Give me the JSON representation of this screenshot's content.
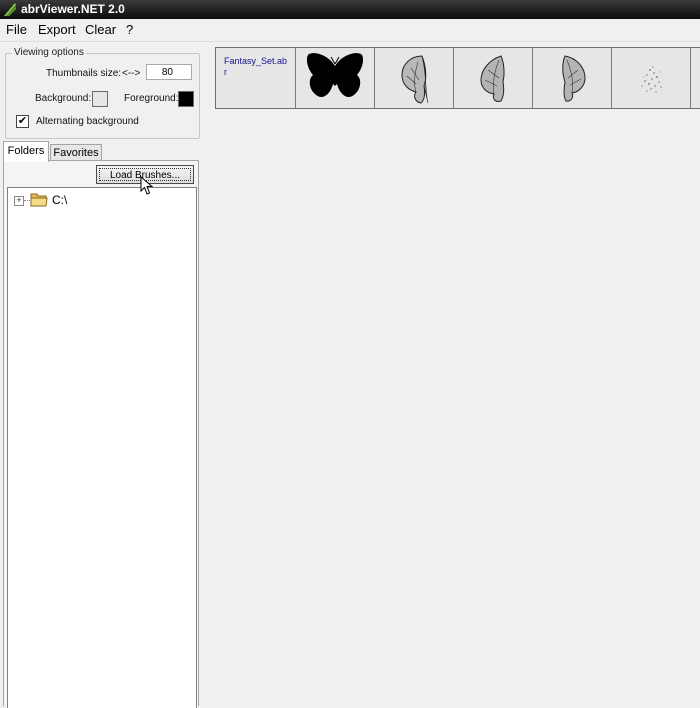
{
  "window": {
    "title": "abrViewer.NET 2.0"
  },
  "menu": [
    {
      "label": "File"
    },
    {
      "label": "Export"
    },
    {
      "label": "Clear"
    },
    {
      "label": "?"
    }
  ],
  "viewing_options": {
    "title": "Viewing options",
    "thumb_label": "Thumbnails size:",
    "thumb_arrows": "<-->",
    "thumb_value": "80",
    "background_label": "Background:",
    "background_color": "#e6e6e6",
    "foreground_label": "Foreground:",
    "foreground_color": "#000000",
    "alternating_label": "Alternating background",
    "alternating_checked": true
  },
  "tabs": [
    {
      "label": "Folders",
      "active": true
    },
    {
      "label": "Favorites",
      "active": false
    }
  ],
  "load_button": "Load Brushes...",
  "tree": [
    {
      "label": "C:\\",
      "icon": "folder-icon",
      "expander": "+"
    }
  ],
  "brush_set": {
    "name": "Fantasy_Set.abr",
    "thumbnails": [
      "butterfly-silhouette",
      "wing-pair-a",
      "wing-single-a",
      "wing-single-b",
      "sparkle-dust"
    ]
  },
  "colors": {
    "titlebar": "#1a1a1a",
    "link_text": "#14148c",
    "panel_bg": "#f0f0f0"
  }
}
